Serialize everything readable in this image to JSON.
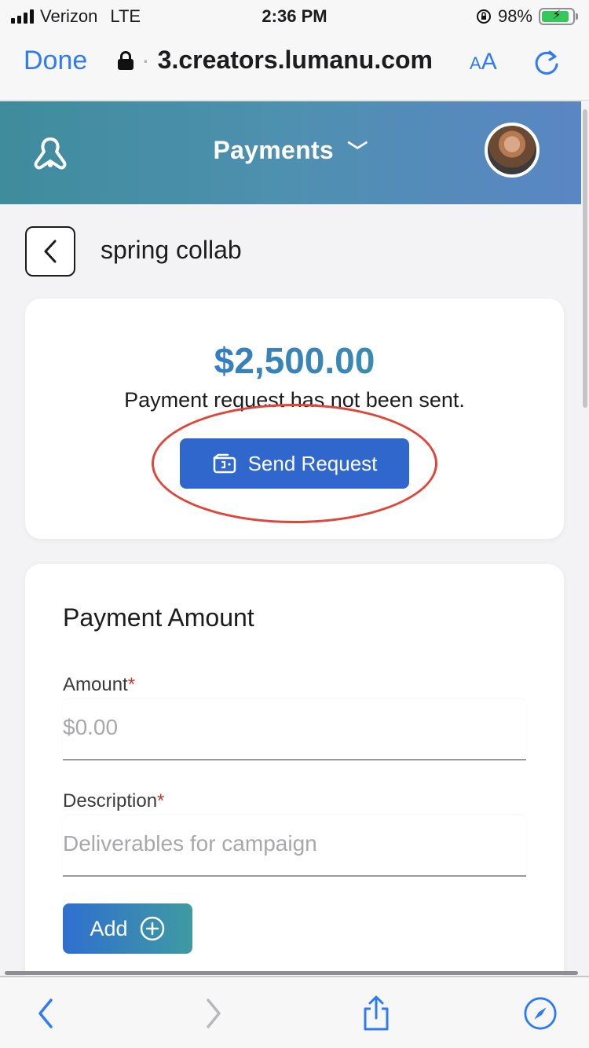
{
  "status_bar": {
    "carrier": "Verizon",
    "network": "LTE",
    "time": "2:36 PM",
    "battery": "98%"
  },
  "browser": {
    "done_label": "Done",
    "url": "3.creators.lumanu.com",
    "text_size_label_small": "A",
    "text_size_label_large": "A"
  },
  "header": {
    "title": "Payments",
    "chevron": "﹀"
  },
  "page": {
    "title": "spring collab"
  },
  "summary": {
    "amount": "$2,500.00",
    "status": "Payment request has not been sent.",
    "send_label": "Send Request"
  },
  "payment_form": {
    "title": "Payment Amount",
    "amount_label": "Amount",
    "amount_placeholder": "$0.00",
    "description_label": "Description",
    "description_placeholder": "Deliverables for campaign",
    "required_mark": "*",
    "add_label": "Add"
  },
  "colors": {
    "accent": "#2f67cd",
    "header_gradient_start": "#3f8c9c",
    "header_gradient_end": "#5a86c4",
    "highlight": "#e0453a",
    "ios_blue": "#2f7bf5"
  },
  "icons": {
    "back": "chevron-left-icon",
    "send": "wallet-icon",
    "add": "plus-circle-icon",
    "share": "share-icon",
    "compass": "compass-icon"
  }
}
